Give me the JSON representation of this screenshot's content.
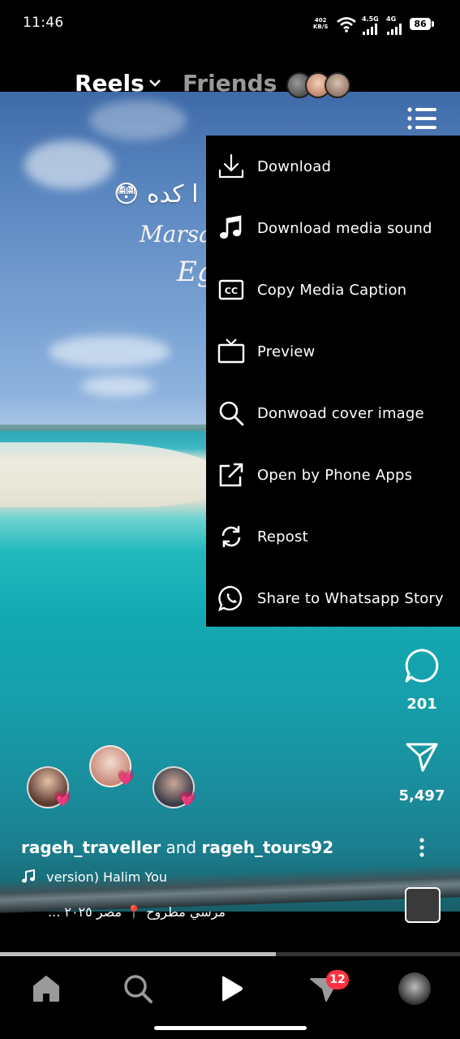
{
  "status_bar": {
    "time": "11:46",
    "net_speed_value": "402",
    "net_speed_unit": "KB/S",
    "signal1_label": "4.5G",
    "signal2_label": "4G",
    "battery": "86"
  },
  "header": {
    "tab_reels": "Reels",
    "tab_friends": "Friends"
  },
  "video_overlay": {
    "line1": "ا كده",
    "emoji": "😳",
    "line2": "Marsa",
    "line3": "Eg"
  },
  "menu": {
    "items": [
      {
        "label": "Download",
        "icon": "download-icon"
      },
      {
        "label": "Download media sound",
        "icon": "music-note-icon"
      },
      {
        "label": "Copy Media Caption",
        "icon": "closed-caption-icon"
      },
      {
        "label": "Preview",
        "icon": "tv-icon"
      },
      {
        "label": "Donwoad cover image",
        "icon": "search-icon"
      },
      {
        "label": "Open by Phone Apps",
        "icon": "external-link-icon"
      },
      {
        "label": "Repost",
        "icon": "repost-icon"
      },
      {
        "label": "Share to Whatsapp Story",
        "icon": "whatsapp-icon"
      }
    ]
  },
  "actions": {
    "comments_count": "201",
    "shares_count": "5,497"
  },
  "reel": {
    "author1": "rageh_traveller",
    "and": "and",
    "author2": "rageh_tours92",
    "music_text": "version)    Halim You",
    "location_text": "مرسي مطروح 📍 مصر ٢٠٢٥ ..."
  },
  "progress": {
    "fraction": 0.6
  },
  "nav": {
    "messages_badge": "12"
  }
}
